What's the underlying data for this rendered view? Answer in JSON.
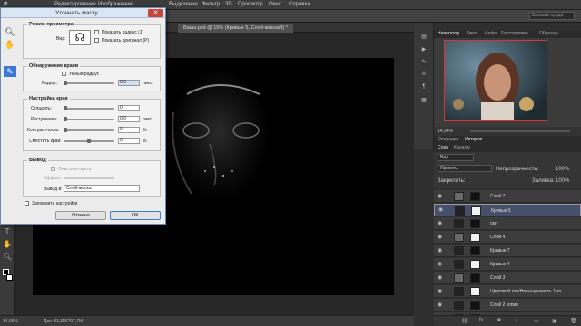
{
  "app": {
    "menu": [
      "Редактирование",
      "Изображение",
      "Выделение",
      "Фильтр",
      "3D",
      "Просмотр",
      "Окно",
      "Справка"
    ],
    "search_placeholder": "Базовая среда",
    "doc_tab": "Ваша.psd @ 15% (Кривые 5, Слой-маска/8) *",
    "status_zoom": "14,96%",
    "status_doc": "Док: 81,3M/707,7M"
  },
  "dialog": {
    "title": "Уточнить маску",
    "close_glyph": "✕",
    "view_mode": {
      "title": "Режим просмотра",
      "view_label": "Вид:",
      "show_radius": "Показать радиус (J)",
      "show_original": "Показать оригинал (P)"
    },
    "edge_detection": {
      "title": "Обнаружение краев",
      "smart_radius": "Умный радиус",
      "radius_label": "Радиус:",
      "radius_value": "0,0",
      "radius_unit": "пикс."
    },
    "adjust_edge": {
      "title": "Настройка края",
      "smooth_label": "Сгладить:",
      "smooth_value": "0",
      "feather_label": "Растушевка:",
      "feather_value": "0,0",
      "feather_unit": "пикс.",
      "contrast_label": "Контрастность:",
      "contrast_value": "0",
      "contrast_unit": "%",
      "shift_label": "Сместить край:",
      "shift_value": "0",
      "shift_unit": "%",
      "shift_level": 0.5
    },
    "output": {
      "title": "Вывод",
      "decontaminate": "Очистить цвета",
      "amount_label": "Эффект:",
      "output_to_label": "Вывод в:",
      "output_to_value": "Слой-маска"
    },
    "remember": "Запомнить настройки",
    "cancel": "Отмена",
    "ok": "OK"
  },
  "panels": {
    "nav_tabs": [
      "Навигатор",
      "Цвет",
      "Инфо",
      "Гистограмма",
      "Образцы"
    ],
    "nav_zoom": "14,96%",
    "hist_tabs": [
      "Операции",
      "История"
    ],
    "layers_tabs": [
      "Слои",
      "Каналы"
    ],
    "kind": "Вид",
    "blend_mode": "Яркость",
    "opacity_label": "Непрозрачность:",
    "opacity_value": "100%",
    "lock_label": "Закрепить:",
    "fill_label": "Заливка:",
    "fill_value": "100%",
    "layers": [
      {
        "name": "Слой 7",
        "selected": false
      },
      {
        "name": "Кривые 5",
        "selected": true
      },
      {
        "name": "смт",
        "selected": false
      },
      {
        "name": "Слой 4",
        "selected": false
      },
      {
        "name": "Кривые 7",
        "selected": false
      },
      {
        "name": "Кривые 4",
        "selected": false
      },
      {
        "name": "Слой 3",
        "selected": false
      },
      {
        "name": "Цветовой тон/Насыщенность 1 ко...",
        "selected": false
      },
      {
        "name": "Слой 2 копия",
        "selected": false
      },
      {
        "name": "Слой 2",
        "selected": false
      }
    ]
  },
  "colors": {
    "dialog_bg": "#ececec",
    "selected_layer": "#47506a",
    "accent": "#3d78d8"
  }
}
